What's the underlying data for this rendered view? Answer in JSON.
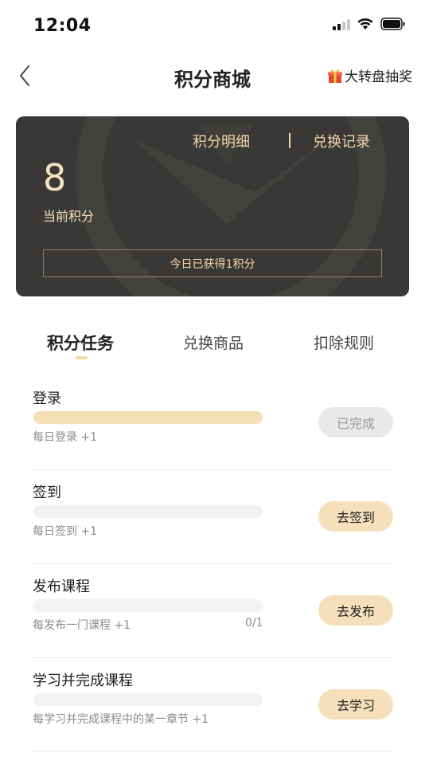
{
  "status_bar": {
    "time": "12:04"
  },
  "nav": {
    "title": "积分商城",
    "lottery_label": "大转盘抽奖"
  },
  "points_card": {
    "detail_link": "积分明细",
    "history_link": "兑换记录",
    "points": "8",
    "points_label": "当前积分",
    "today_earned": "今日已获得1积分"
  },
  "tabs": [
    {
      "label": "积分任务",
      "active": true
    },
    {
      "label": "兑换商品",
      "active": false
    },
    {
      "label": "扣除规则",
      "active": false
    }
  ],
  "tasks": [
    {
      "title": "登录",
      "description": "每日登录 +1",
      "count": "",
      "progress": 1.0,
      "button": "已完成",
      "completed": true
    },
    {
      "title": "签到",
      "description": "每日签到 +1",
      "count": "",
      "progress": 0.0,
      "button": "去签到",
      "completed": false
    },
    {
      "title": "发布课程",
      "description": "每发布一门课程 +1",
      "count": "0/1",
      "progress": 0.0,
      "button": "去发布",
      "completed": false
    },
    {
      "title": "学习并完成课程",
      "description": "每学习并完成课程中的某一章节 +1",
      "count": "",
      "progress": 0.0,
      "button": "去学习",
      "completed": false
    }
  ],
  "colors": {
    "card_bg": "#3a3836",
    "gold_text": "#f2d9a8",
    "button_active": "#f6e0bb",
    "button_done": "#e9e9e9",
    "progress_fill": "#f5dfb6"
  }
}
